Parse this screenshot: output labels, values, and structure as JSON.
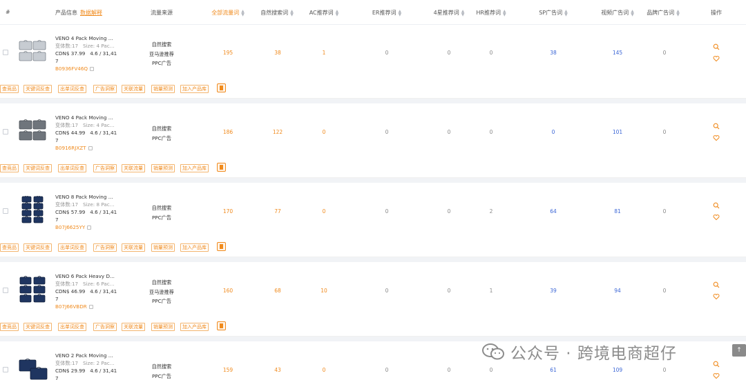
{
  "header": {
    "col_index": "#",
    "col_product": "产品信息",
    "col_product_link": "数据解释",
    "col_traffic_source": "流量来源",
    "col_all_traffic": "全部流量词",
    "col_organic": "自然搜索词",
    "col_ac": "AC推荐词",
    "col_er": "ER推荐词",
    "col_4star": "4星推荐词",
    "col_hr": "HR推荐词",
    "col_sp": "SP广告词",
    "col_video": "视频广告词",
    "col_brand": "品牌广告词",
    "col_ops": "操作"
  },
  "action_tags": [
    "查竞品",
    "关键词反查",
    "出单词反查",
    "广告洞察",
    "关联流量",
    "销量预测",
    "加入产品库"
  ],
  "products": [
    {
      "title": "VENO 4 Pack Moving ...",
      "variants": "变体数:17",
      "size": "Size: 4 Pac...",
      "price": "CDN$ 37.99",
      "rating": "4.6 / 31,41",
      "rating_tail": "7",
      "asin": "B0936FV46Q",
      "traffic": [
        "自然搜索",
        "亚马逊推荐",
        "PPC广告"
      ],
      "all": "195",
      "organic": "38",
      "ac": "1",
      "er": "0",
      "star4": "0",
      "hr": "0",
      "sp": "38",
      "video": "145",
      "brand": "0",
      "thumb": "silver"
    },
    {
      "title": "VENO 4 Pack Moving ...",
      "variants": "变体数:17",
      "size": "Size: 4 Pac...",
      "price": "CDN$ 44.99",
      "rating": "4.6 / 31,41",
      "rating_tail": "7",
      "asin": "B0916RJXZT",
      "traffic": [
        "自然搜索",
        "PPC广告"
      ],
      "all": "186",
      "organic": "122",
      "ac": "0",
      "er": "0",
      "star4": "0",
      "hr": "0",
      "sp": "0",
      "video": "101",
      "brand": "0",
      "thumb": "gray"
    },
    {
      "title": "VENO 8 Pack Moving ...",
      "variants": "变体数:17",
      "size": "Size: 8 Pac...",
      "price": "CDN$ 57.99",
      "rating": "4.6 / 31,41",
      "rating_tail": "7",
      "asin": "B07J6625YY",
      "traffic": [
        "自然搜索",
        "PPC广告"
      ],
      "all": "170",
      "organic": "77",
      "ac": "0",
      "er": "0",
      "star4": "0",
      "hr": "2",
      "sp": "64",
      "video": "81",
      "brand": "0",
      "thumb": "navy8"
    },
    {
      "title": "VENO 6 Pack Heavy D...",
      "variants": "变体数:17",
      "size": "Size: 6 Pac...",
      "price": "CDN$ 46.99",
      "rating": "4.6 / 31,41",
      "rating_tail": "7",
      "asin": "B07J66VBDR",
      "traffic": [
        "自然搜索",
        "亚马逊推荐",
        "PPC广告"
      ],
      "all": "160",
      "organic": "68",
      "ac": "10",
      "er": "0",
      "star4": "0",
      "hr": "1",
      "sp": "39",
      "video": "94",
      "brand": "0",
      "thumb": "navy6"
    },
    {
      "title": "VENO 2 Pack Moving ...",
      "variants": "变体数:17",
      "size": "Size: 2 Pac...",
      "price": "CDN$ 29.99",
      "rating": "4.6 / 31,41",
      "rating_tail": "7",
      "asin": "",
      "traffic": [
        "自然搜索",
        "PPC广告"
      ],
      "all": "159",
      "organic": "43",
      "ac": "0",
      "er": "0",
      "star4": "0",
      "hr": "0",
      "sp": "61",
      "video": "109",
      "brand": "0",
      "thumb": "navy2"
    }
  ],
  "watermark": "公众号 · 跨境电商超仔",
  "scroll_top_label": "↑",
  "colors": {
    "accent": "#f08a1c",
    "link_blue": "#3b66d6",
    "divider_band": "#f1f3f6"
  }
}
